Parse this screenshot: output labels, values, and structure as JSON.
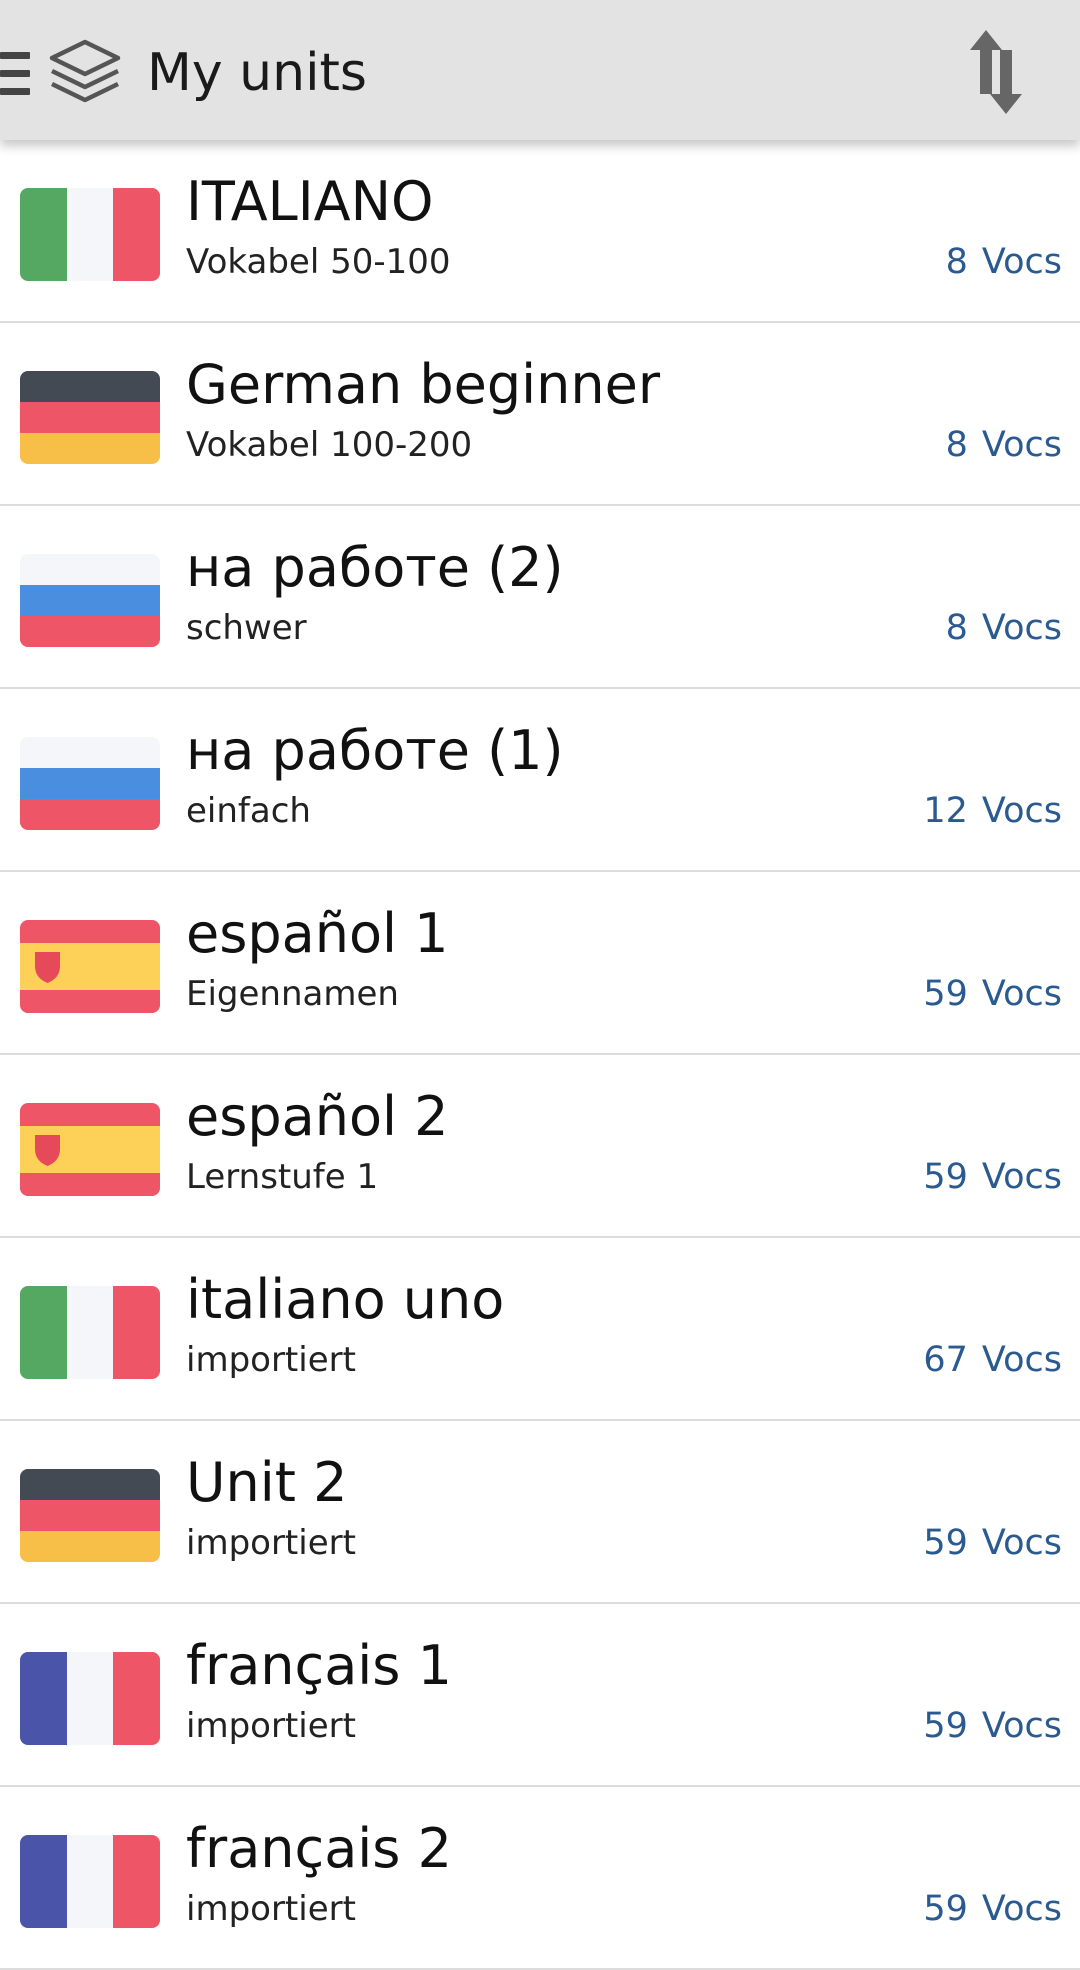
{
  "header": {
    "title": "My units",
    "menu_icon": "hamburger-menu-icon",
    "logo_icon": "layers-icon",
    "sort_icon": "sort-arrows-icon",
    "background": "#e3e3e3"
  },
  "colors": {
    "accent": "#2a5a8f",
    "divider": "#dcdcdc"
  },
  "units": [
    {
      "title": "ITALIANO",
      "subtitle": "Vokabel 50-100",
      "count": "8",
      "count_label": "Vocs",
      "flag": "italy"
    },
    {
      "title": "German beginner",
      "subtitle": "Vokabel 100-200",
      "count": "8",
      "count_label": "Vocs",
      "flag": "germany"
    },
    {
      "title": "на работе (2)",
      "subtitle": "schwer",
      "count": "8",
      "count_label": "Vocs",
      "flag": "russia"
    },
    {
      "title": "на работе (1)",
      "subtitle": "einfach",
      "count": "12",
      "count_label": "Vocs",
      "flag": "russia"
    },
    {
      "title": "español 1",
      "subtitle": "Eigennamen",
      "count": "59",
      "count_label": "Vocs",
      "flag": "spain"
    },
    {
      "title": "español 2",
      "subtitle": "Lernstufe 1",
      "count": "59",
      "count_label": "Vocs",
      "flag": "spain"
    },
    {
      "title": "italiano uno",
      "subtitle": "importiert",
      "count": "67",
      "count_label": "Vocs",
      "flag": "italy"
    },
    {
      "title": "Unit 2",
      "subtitle": "importiert",
      "count": "59",
      "count_label": "Vocs",
      "flag": "germany"
    },
    {
      "title": "français 1",
      "subtitle": "importiert",
      "count": "59",
      "count_label": "Vocs",
      "flag": "france"
    },
    {
      "title": "français 2",
      "subtitle": "importiert",
      "count": "59",
      "count_label": "Vocs",
      "flag": "france"
    }
  ]
}
